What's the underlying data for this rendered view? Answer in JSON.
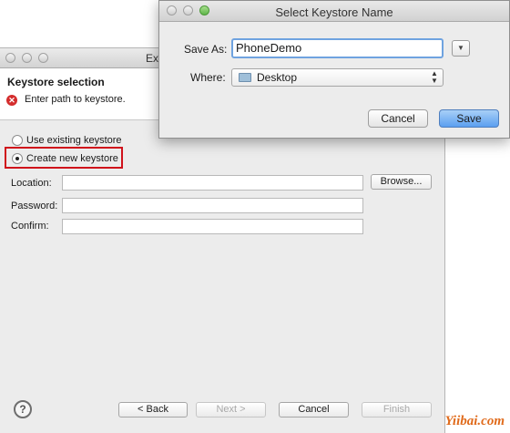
{
  "wizard": {
    "title_visible": "Ex",
    "header_title": "Keystore selection",
    "header_message": "Enter path to keystore.",
    "radio_existing": "Use existing keystore",
    "radio_new": "Create new keystore",
    "location_label": "Location:",
    "password_label": "Password:",
    "confirm_label": "Confirm:",
    "browse_label": "Browse...",
    "back_label": "< Back",
    "next_label": "Next >",
    "cancel_label": "Cancel",
    "finish_label": "Finish",
    "help_glyph": "?"
  },
  "dialog": {
    "title": "Select Keystore Name",
    "save_as_label": "Save As:",
    "save_as_value": "PhoneDemo",
    "where_label": "Where:",
    "where_value": "Desktop",
    "cancel_label": "Cancel",
    "save_label": "Save",
    "expand_glyph": "▼",
    "stepper_glyph": "▲▼"
  },
  "watermark": "Yiibai.com",
  "colors": {
    "highlight_border": "#d0121b",
    "save_button": "#5b9ff0",
    "error_icon": "#d42d2d",
    "watermark": "#e06b1c"
  }
}
